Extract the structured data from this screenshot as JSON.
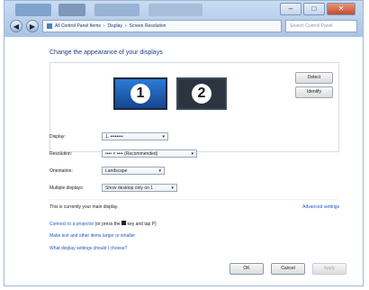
{
  "window": {
    "breadcrumb": [
      "All Control Panel Items",
      "Display",
      "Screen Resolution"
    ],
    "search_placeholder": "Search Control Panel",
    "minimize": "–",
    "maximize": "□",
    "close": "✕"
  },
  "page": {
    "title": "Change the appearance of your displays",
    "detect_label": "Detect",
    "identify_label": "Identify",
    "monitor1_number": "1",
    "monitor2_number": "2",
    "display_label": "Display:",
    "display_value": "1. ••••••••",
    "resolution_label": "Resolution:",
    "resolution_value": "•••• × •••• (Recommended)",
    "orientation_label": "Orientation:",
    "orientation_value": "Landscape",
    "multiple_label": "Multiple displays:",
    "multiple_value": "Show desktop only on 1",
    "current_text": "This is currently your main display.",
    "advanced_link": "Advanced settings",
    "link_projector_a": "Connect to a projector",
    "link_projector_b": "(or press the",
    "link_projector_c": "key and tap P)",
    "link_text_size": "Make text and other items larger or smaller",
    "link_settings": "What display settings should I choose?",
    "ok": "OK",
    "cancel": "Cancel",
    "apply": "Apply"
  }
}
